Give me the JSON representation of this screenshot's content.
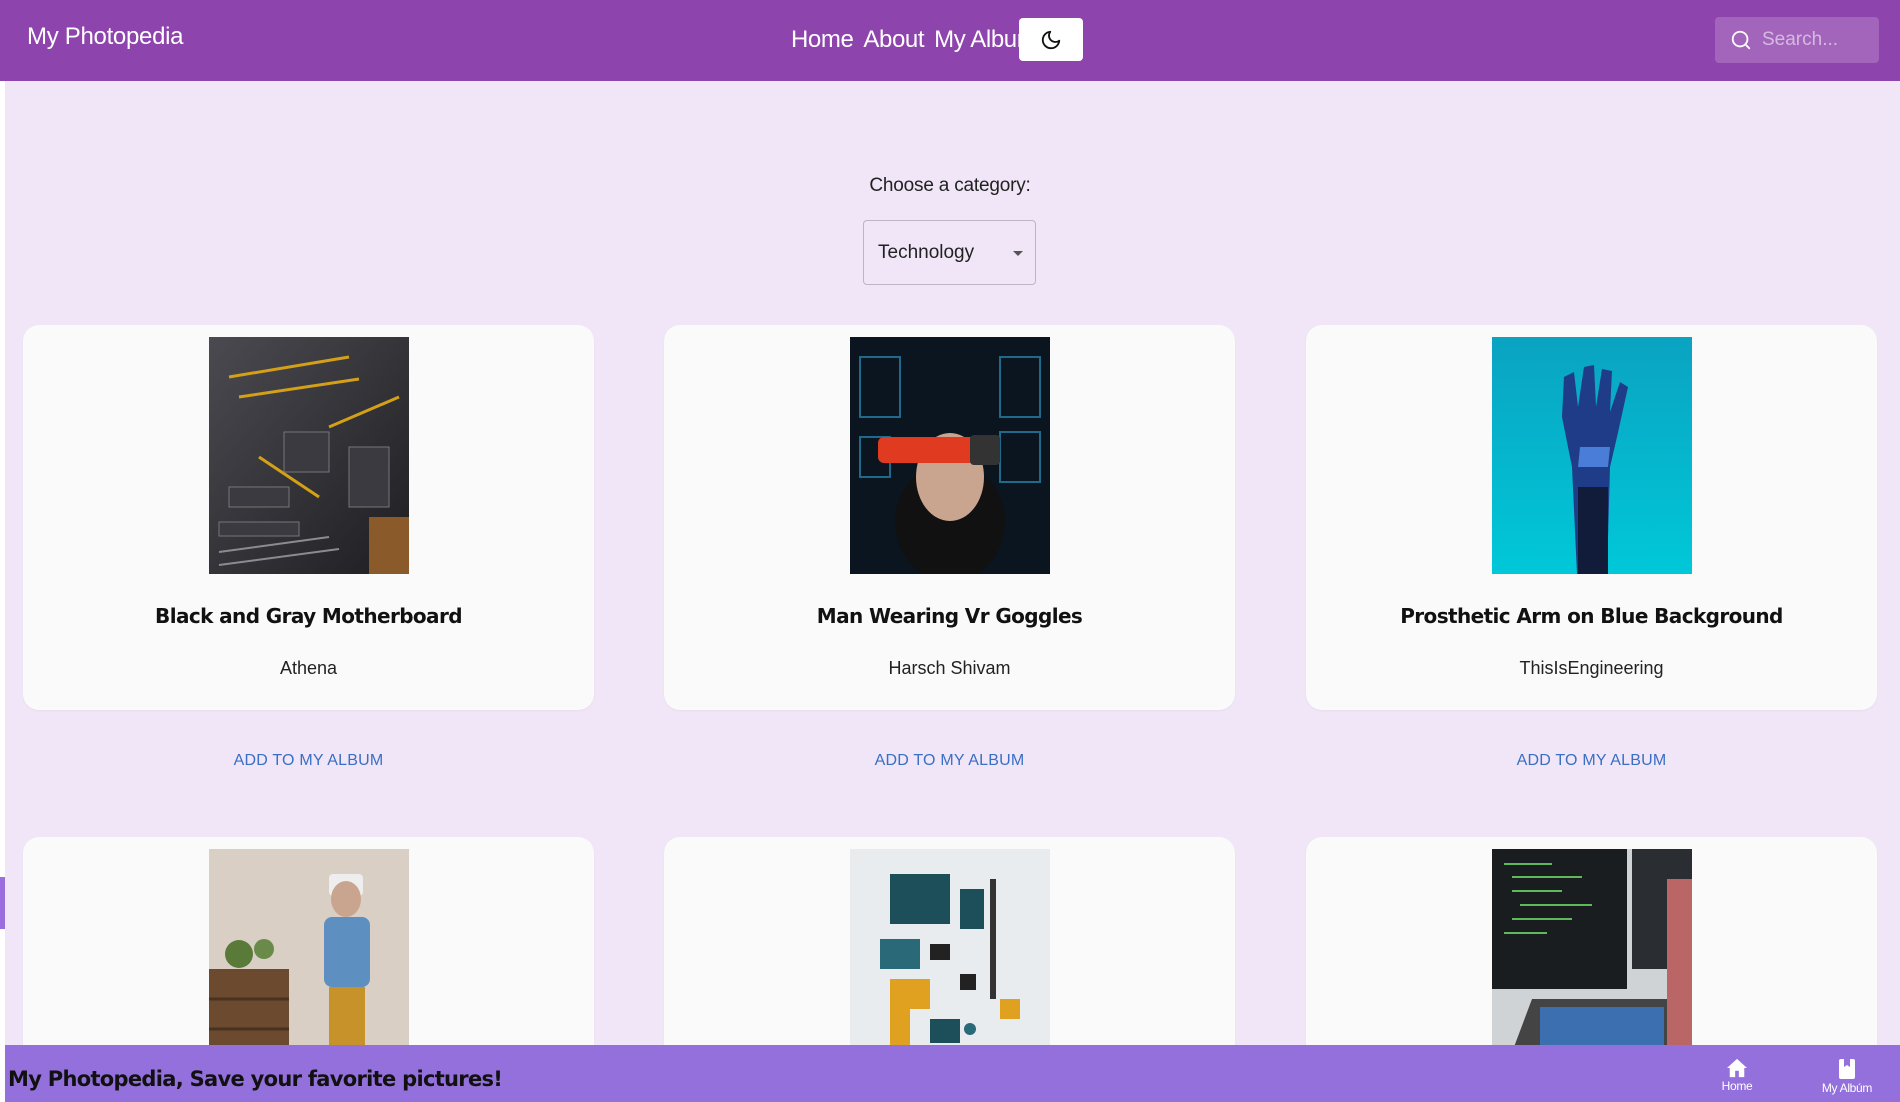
{
  "header": {
    "brand": "My Photopedia",
    "nav": [
      "Home",
      "About",
      "My Album"
    ],
    "search_placeholder": "Search...",
    "theme_icon": "moon-icon"
  },
  "category": {
    "label": "Choose a category:",
    "selected": "Technology"
  },
  "cards": [
    {
      "title": "Black and Gray Motherboard",
      "author": "Athena"
    },
    {
      "title": "Man Wearing Vr Goggles",
      "author": "Harsch Shivam"
    },
    {
      "title": "Prosthetic Arm on Blue Background",
      "author": "ThisIsEngineering"
    },
    {
      "title": "",
      "author": ""
    },
    {
      "title": "",
      "author": ""
    },
    {
      "title": "",
      "author": ""
    }
  ],
  "add_label": "ADD TO MY ALBUM",
  "footer": {
    "text": "My Photopedia, Save your favorite pictures!",
    "nav": [
      {
        "label": "Home",
        "icon": "home-icon"
      },
      {
        "label": "My Albúm",
        "icon": "bookmark-icon"
      }
    ]
  },
  "colors": {
    "appbar": "#8e44ad",
    "background": "#f0e6f7",
    "bottombar": "#9370db",
    "link": "#3a6fc4"
  }
}
